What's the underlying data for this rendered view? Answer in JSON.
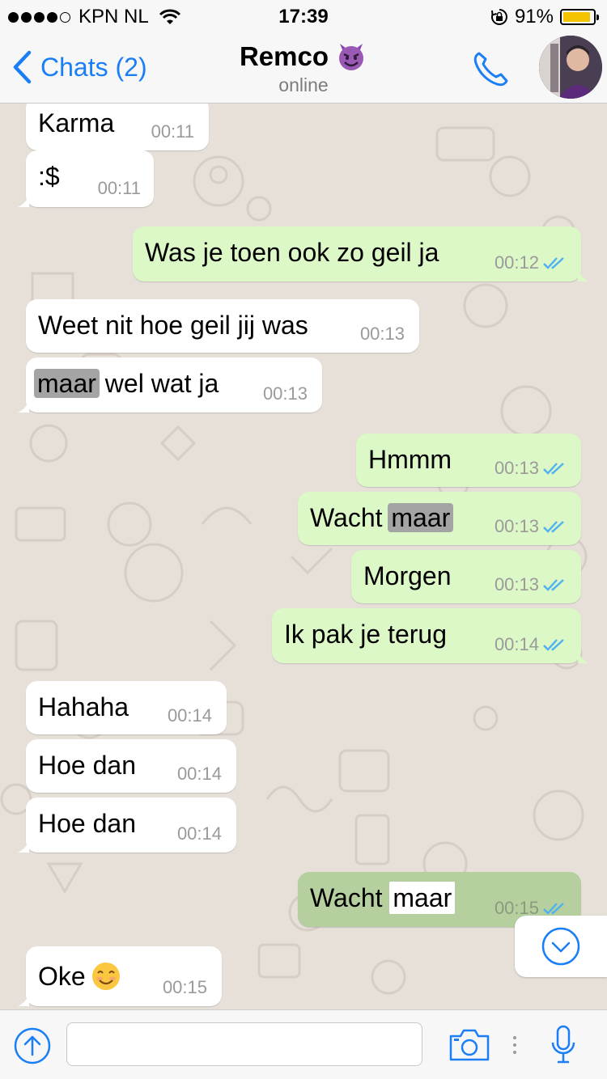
{
  "status": {
    "carrier": "KPN NL",
    "time": "17:39",
    "battery": "91%",
    "battery_level": 0.91,
    "signal_bars": 4,
    "signal_max": 5
  },
  "nav": {
    "back_label": "Chats (2)",
    "contact_name": "Remco",
    "contact_emoji": "smiling-devil-emoji",
    "status": "online"
  },
  "messages": [
    {
      "dir": "in",
      "text": "Karma",
      "time": "00:11"
    },
    {
      "dir": "in",
      "text": ":$",
      "time": "00:11"
    },
    {
      "dir": "out",
      "text": "Was je toen ook zo geil ja",
      "time": "00:12",
      "status": "read"
    },
    {
      "dir": "in",
      "text": "Weet nit hoe geil jij was",
      "time": "00:13"
    },
    {
      "dir": "in",
      "text_pre": "",
      "highlight": "maar",
      "text_post": " wel wat ja",
      "time": "00:13"
    },
    {
      "dir": "out",
      "text": "Hmmm",
      "time": "00:13",
      "status": "read"
    },
    {
      "dir": "out",
      "text_pre": "Wacht ",
      "highlight": "maar",
      "text_post": "",
      "time": "00:13",
      "status": "read"
    },
    {
      "dir": "out",
      "text": "Morgen",
      "time": "00:13",
      "status": "read"
    },
    {
      "dir": "out",
      "text": "Ik pak je terug",
      "time": "00:14",
      "status": "read"
    },
    {
      "dir": "in",
      "text": "Hahaha",
      "time": "00:14"
    },
    {
      "dir": "in",
      "text": "Hoe dan",
      "time": "00:14"
    },
    {
      "dir": "in",
      "text": "Hoe dan",
      "time": "00:14"
    },
    {
      "dir": "out",
      "text_pre": "Wacht ",
      "highlight": "maar",
      "text_post": "",
      "time": "00:15",
      "status": "read",
      "selected": true
    },
    {
      "dir": "in",
      "text": "Oke",
      "emoji": "smiling-face-emoji",
      "time": "00:15"
    }
  ],
  "input": {
    "value": "",
    "placeholder": ""
  },
  "colors": {
    "accent": "#1a7ef4",
    "outgoing_bubble": "#dcf8c6",
    "incoming_bubble": "#ffffff",
    "read_ticks": "#4fb1f0"
  }
}
